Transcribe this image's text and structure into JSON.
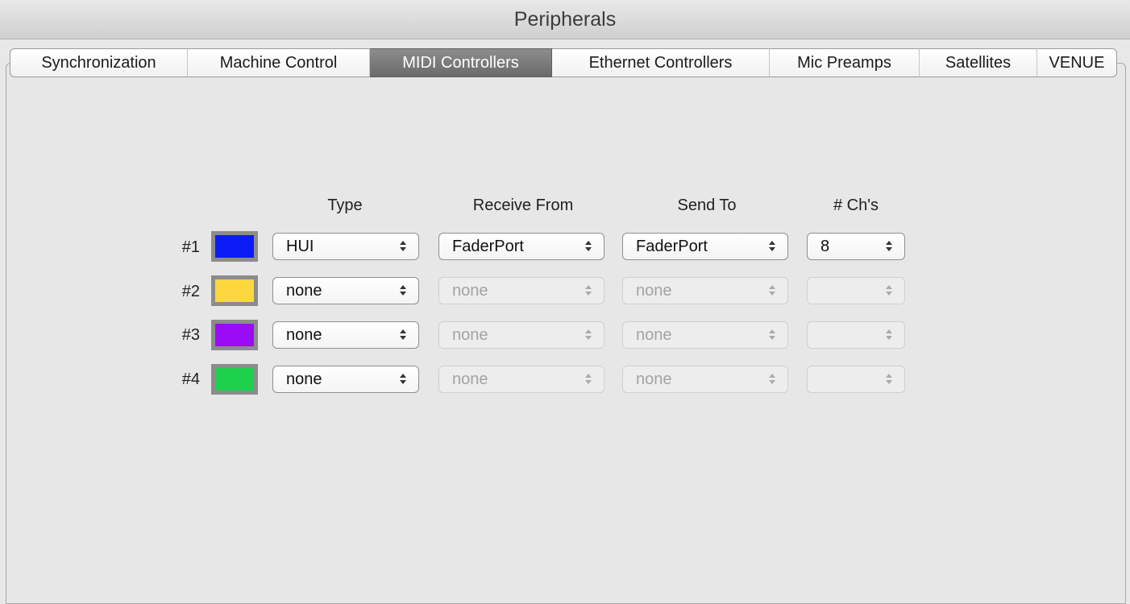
{
  "window": {
    "title": "Peripherals"
  },
  "tabs": [
    {
      "label": "Synchronization",
      "active": false
    },
    {
      "label": "Machine Control",
      "active": false
    },
    {
      "label": "MIDI Controllers",
      "active": true
    },
    {
      "label": "Ethernet Controllers",
      "active": false
    },
    {
      "label": "Mic Preamps",
      "active": false
    },
    {
      "label": "Satellites",
      "active": false
    },
    {
      "label": "VENUE",
      "active": false
    }
  ],
  "columns": {
    "type": "Type",
    "receive_from": "Receive From",
    "send_to": "Send To",
    "channels": "# Ch's"
  },
  "controllers": [
    {
      "label": "#1",
      "color": "#0b1cf7",
      "type": "HUI",
      "receive_from": "FaderPort",
      "send_to": "FaderPort",
      "channels": "8",
      "enabled": true
    },
    {
      "label": "#2",
      "color": "#fcd83e",
      "type": "none",
      "receive_from": "none",
      "send_to": "none",
      "channels": "",
      "enabled": false
    },
    {
      "label": "#3",
      "color": "#9a0bf6",
      "type": "none",
      "receive_from": "none",
      "send_to": "none",
      "channels": "",
      "enabled": false
    },
    {
      "label": "#4",
      "color": "#1ed14c",
      "type": "none",
      "receive_from": "none",
      "send_to": "none",
      "channels": "",
      "enabled": false
    }
  ],
  "icons": {
    "select_arrows": "updown-arrows-icon"
  }
}
